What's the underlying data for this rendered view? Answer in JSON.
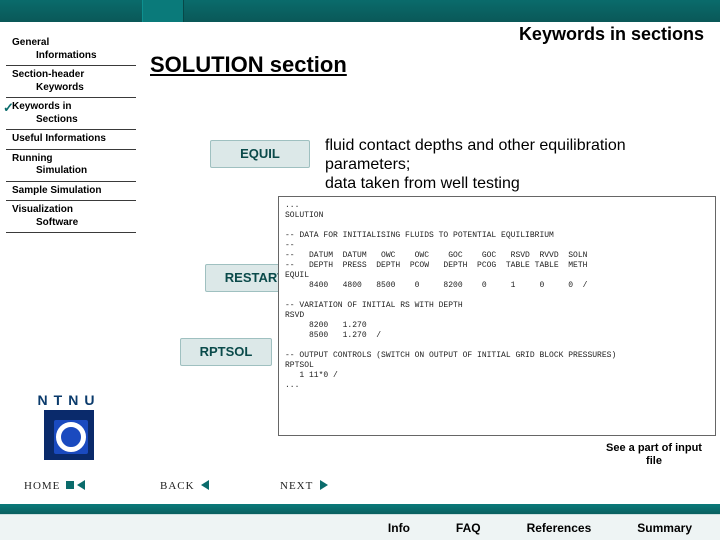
{
  "header": {
    "slide_group": "Keywords in sections"
  },
  "main": {
    "title": "SOLUTION section",
    "keywords": [
      {
        "label": "EQUIL"
      },
      {
        "label": "RESTART"
      },
      {
        "label": "RPTSOL"
      }
    ],
    "description": "fluid contact depths and other equilibration parameters;\ndata taken from well testing",
    "code": "...\nSOLUTION\n\n-- DATA FOR INITIALISING FLUIDS TO POTENTIAL EQUILIBRIUM\n--\n--   DATUM  DATUM   OWC    OWC    GOC    GOC   RSVD  RVVD  SOLN\n--   DEPTH  PRESS  DEPTH  PCOW   DEPTH  PCOG  TABLE TABLE  METH\nEQUIL\n     8400   4800   8500    0     8200    0     1     0     0  /\n\n-- VARIATION OF INITIAL RS WITH DEPTH\nRSVD\n     8200   1.270\n     8500   1.270  /\n\n-- OUTPUT CONTROLS (SWITCH ON OUTPUT OF INITIAL GRID BLOCK PRESSURES)\nRPTSOL\n   1 11*0 /\n...\n",
    "caption": "See a part of input file"
  },
  "sidebar": {
    "items": [
      {
        "line1": "General",
        "line2": "Informations"
      },
      {
        "line1": "Section-header",
        "line2": "Keywords"
      },
      {
        "line1": "Keywords in",
        "line2": "Sections"
      },
      {
        "line1": "Useful Informations",
        "line2": ""
      },
      {
        "line1": "Running",
        "line2": "Simulation"
      },
      {
        "line1": "Sample Simulation",
        "line2": ""
      },
      {
        "line1": "Visualization",
        "line2": "Software"
      }
    ],
    "active_index": 2
  },
  "logo": {
    "text": "NTNU"
  },
  "nav": {
    "home": "HOME",
    "back": "BACK",
    "next": "NEXT"
  },
  "footer": {
    "links": [
      "Info",
      "FAQ",
      "References",
      "Summary"
    ]
  }
}
